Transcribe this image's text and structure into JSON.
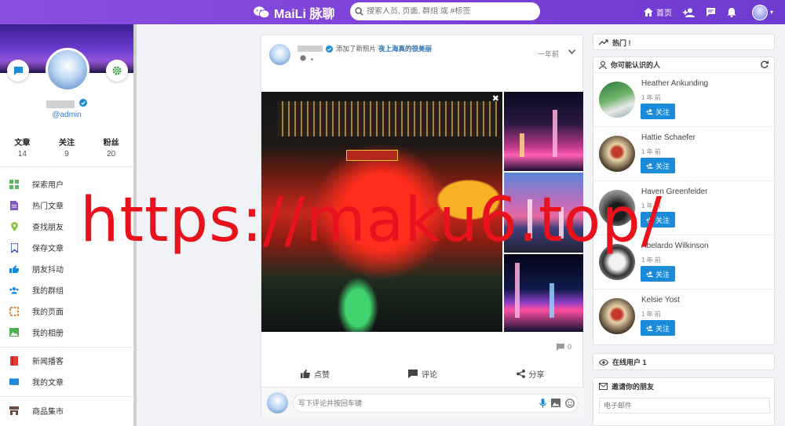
{
  "app": {
    "title": "MaiLi 脉聊",
    "brand_color": "#7b3fd6"
  },
  "search": {
    "placeholder": "搜索人员, 页面, 群组 或 #标签"
  },
  "topnav": {
    "home_label": "首页",
    "icons": [
      "home-icon",
      "add-friend-icon",
      "messages-icon",
      "notifications-icon",
      "user-avatar"
    ]
  },
  "profile": {
    "handle": "@admin",
    "stats": [
      {
        "label": "文章",
        "value": "14"
      },
      {
        "label": "关注",
        "value": "9"
      },
      {
        "label": "粉丝",
        "value": "20"
      }
    ]
  },
  "sidebar": {
    "group1": [
      {
        "label": "探索用户",
        "icon": "explore-icon",
        "color": "#5cb85c"
      },
      {
        "label": "热门文章",
        "icon": "article-icon",
        "color": "#7e57c2"
      },
      {
        "label": "查找朋友",
        "icon": "location-icon",
        "color": "#8bc34a"
      },
      {
        "label": "保存文章",
        "icon": "bookmark-icon",
        "color": "#3f51b5"
      },
      {
        "label": "朋友抖动",
        "icon": "poke-icon",
        "color": "#1a8ad9"
      },
      {
        "label": "我的群组",
        "icon": "group-icon",
        "color": "#1a8ad9"
      },
      {
        "label": "我的页面",
        "icon": "page-icon",
        "color": "#f0893a"
      },
      {
        "label": "我的相册",
        "icon": "album-icon",
        "color": "#4caf50"
      }
    ],
    "group2": [
      {
        "label": "新闻播客",
        "icon": "news-icon",
        "color": "#e53935"
      },
      {
        "label": "我的文章",
        "icon": "book-icon",
        "color": "#1a8ad9"
      }
    ],
    "group3": [
      {
        "label": "商品集市",
        "icon": "market-icon",
        "color": "#6d4c41"
      }
    ]
  },
  "post": {
    "action_text": "添加了新照片",
    "album_name": "夜上海真的很美丽",
    "time": "一年前",
    "comment_count": "0",
    "actions": {
      "like": "点赞",
      "comment": "评论",
      "share": "分享"
    },
    "comment_placeholder": "写下评论并按回车键"
  },
  "right": {
    "trending_title": "热门 !",
    "people_title": "你可能认识的人",
    "follow_label": "关注",
    "people": [
      {
        "name": "Heather Ankunding",
        "time": "1 年 前"
      },
      {
        "name": "Hattie Schaefer",
        "time": "1 年 前"
      },
      {
        "name": "Haven Greenfelder",
        "time": "1 年 前"
      },
      {
        "name": "Abelardo Wilkinson",
        "time": "1 年 前"
      },
      {
        "name": "Kelsie Yost",
        "time": "1 年 前"
      }
    ],
    "online_title": "在线用户 1",
    "invite_title": "邀请你的朋友",
    "email_placeholder": "电子邮件"
  },
  "watermark": "https://maku6.top/"
}
